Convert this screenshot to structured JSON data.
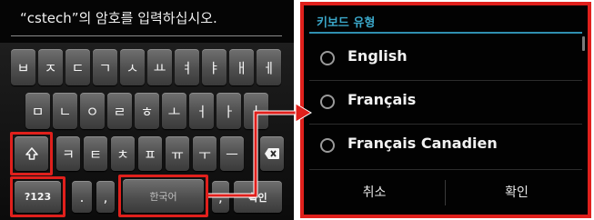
{
  "prompt": {
    "text": "“cstech”의 암호를 입력하십시오."
  },
  "keyboard": {
    "row1": [
      "ㅂ",
      "ㅈ",
      "ㄷ",
      "ㄱ",
      "ㅅ",
      "ㅛ",
      "ㅕ",
      "ㅑ",
      "ㅐ",
      "ㅔ"
    ],
    "row2": [
      "ㅁ",
      "ㄴ",
      "ㅇ",
      "ㄹ",
      "ㅎ",
      "ㅗ",
      "ㅓ",
      "ㅏ",
      "ㅣ"
    ],
    "row3": [
      "ㅋ",
      "ㅌ",
      "ㅊ",
      "ㅍ",
      "ㅠ",
      "ㅜ",
      "ㅡ"
    ],
    "row4": {
      "symbols": "?123",
      "period": ".",
      "comma": ",",
      "space": "한국어",
      "semicolon": ";",
      "enter": "확인"
    },
    "shift_icon": "shift-arrow-icon",
    "backspace_icon": "backspace-icon"
  },
  "dialog": {
    "title": "키보드 유형",
    "options": [
      "English",
      "Français",
      "Français Canadien"
    ],
    "cancel_label": "취소",
    "ok_label": "확인"
  },
  "colors": {
    "highlight": "#e0201c",
    "accent": "#3ba7c9",
    "background": "#050505",
    "key": "#4e4e4e"
  }
}
